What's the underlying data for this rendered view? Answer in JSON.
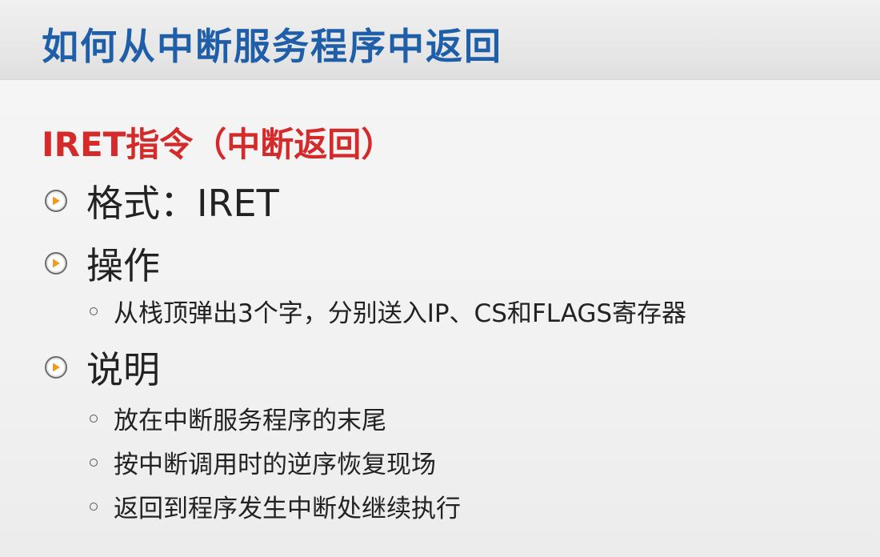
{
  "slide": {
    "title": "如何从中断服务程序中返回",
    "subtitle": "IRET指令（中断返回）",
    "sections": [
      {
        "label": "格式：IRET",
        "items": []
      },
      {
        "label": "操作",
        "items": [
          "从栈顶弹出3个字，分别送入IP、CS和FLAGS寄存器"
        ]
      },
      {
        "label": "说明",
        "items": [
          "放在中断服务程序的末尾",
          "按中断调用时的逆序恢复现场",
          "返回到程序发生中断处继续执行"
        ]
      }
    ]
  },
  "colors": {
    "title": "#1f5ea8",
    "subtitle": "#d42a2a",
    "bullet_accent": "#f39a1e"
  },
  "icons": {
    "level1_bullet": "play-circle-icon",
    "level2_bullet": "hollow-circle-icon"
  }
}
